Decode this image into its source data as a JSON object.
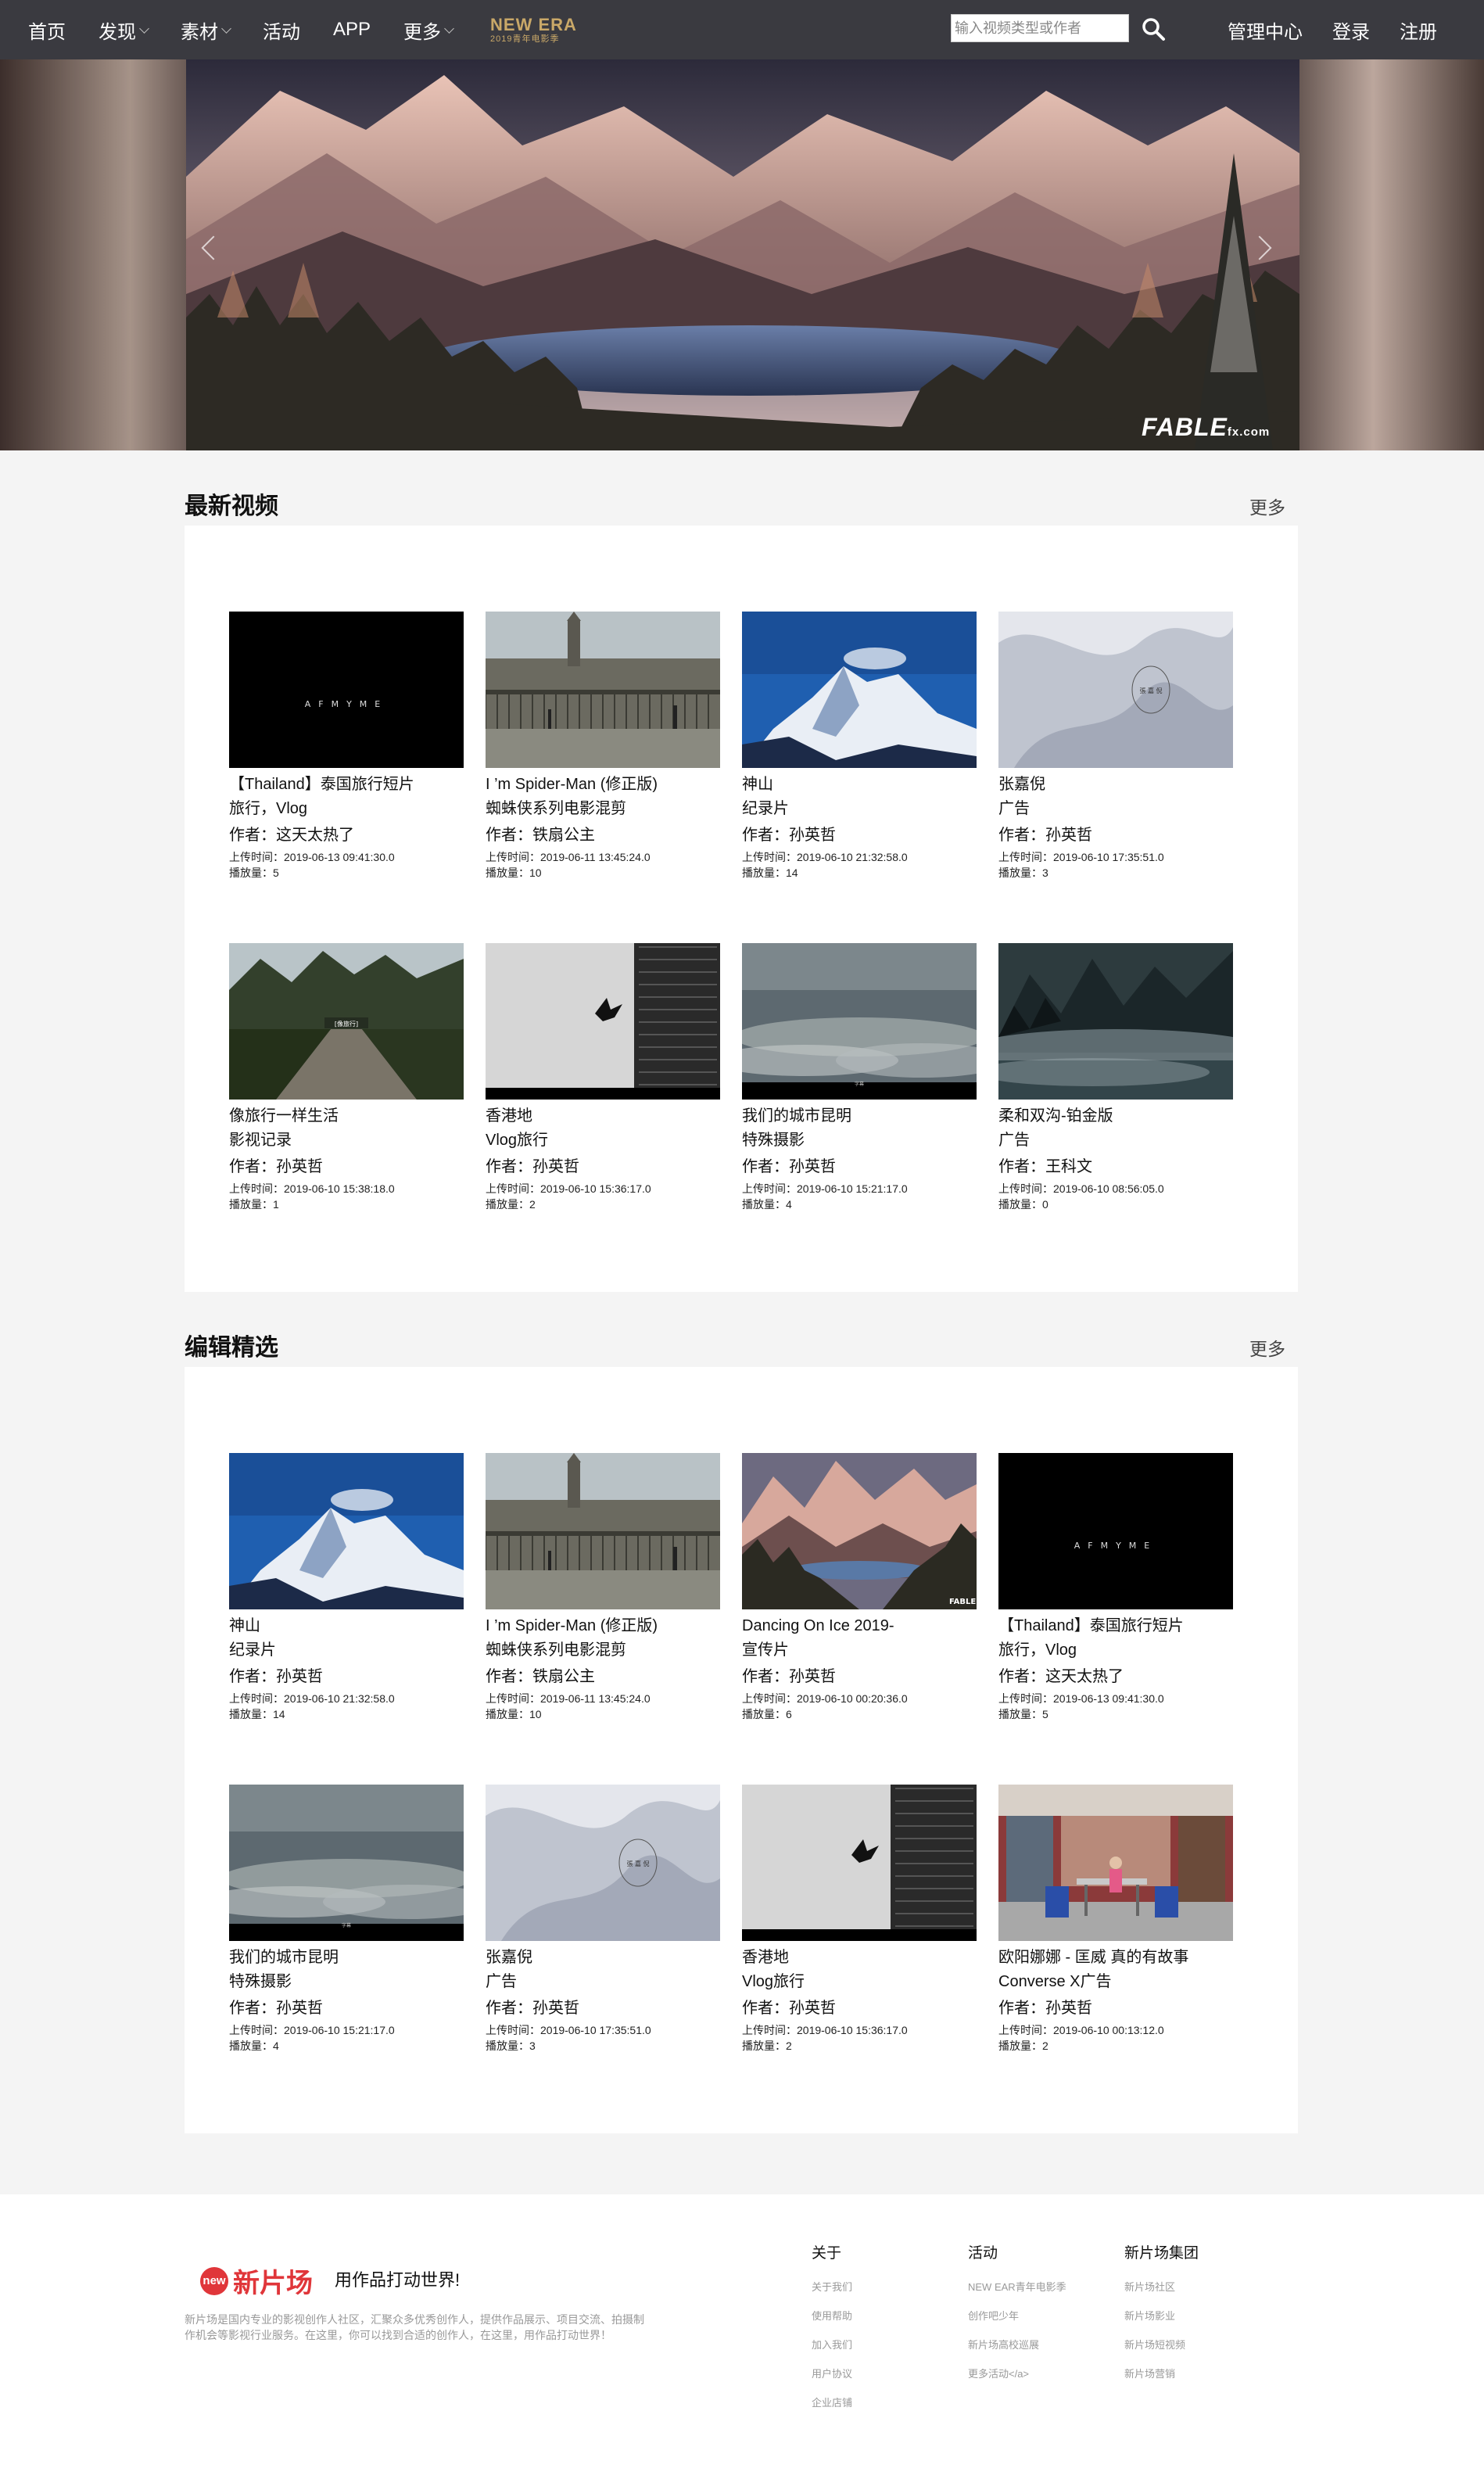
{
  "nav": {
    "items": [
      {
        "label": "首页",
        "dropdown": false
      },
      {
        "label": "发现",
        "dropdown": true
      },
      {
        "label": "素材",
        "dropdown": true
      },
      {
        "label": "活动",
        "dropdown": false
      },
      {
        "label": "APP",
        "dropdown": false
      },
      {
        "label": "更多",
        "dropdown": true
      }
    ],
    "promo_big": "NEW ERA",
    "promo_small": "2019青年电影季",
    "search_placeholder": "输入视频类型或作者",
    "right": [
      "管理中心",
      "登录",
      "注册"
    ]
  },
  "banner": {
    "watermark": "FABLE",
    "watermark_suffix": "fx.com"
  },
  "sections": [
    {
      "title": "最新视频",
      "more": "更多",
      "cards": [
        {
          "title": "【Thailand】泰国旅行短片",
          "category": "旅行，Vlog",
          "author": "作者：这天太热了",
          "upload": "上传时间：2019-06-13 09:41:30.0",
          "plays": "播放量：5",
          "thumb": "afmyme"
        },
        {
          "title": "I ’m Spider-Man (修正版)",
          "category": "蜘蛛侠系列电影混剪",
          "author": "作者：铁扇公主",
          "upload": "上传时间：2019-06-11 13:45:24.0",
          "plays": "播放量：10",
          "thumb": "castle"
        },
        {
          "title": "神山",
          "category": "纪录片",
          "author": "作者：孙英哲",
          "upload": "上传时间：2019-06-10 21:32:58.0",
          "plays": "播放量：14",
          "thumb": "everest"
        },
        {
          "title": "张嘉倪",
          "category": "广告",
          "author": "作者：孙英哲",
          "upload": "上传时间：2019-06-10 17:35:51.0",
          "plays": "播放量：3",
          "thumb": "silk"
        },
        {
          "title": "像旅行一样生活",
          "category": "影视记录",
          "author": "作者：孙英哲",
          "upload": "上传时间：2019-06-10 15:38:18.0",
          "plays": "播放量：1",
          "thumb": "road"
        },
        {
          "title": "香港地",
          "category": "Vlog旅行",
          "author": "作者：孙英哲",
          "upload": "上传时间：2019-06-10 15:36:17.0",
          "plays": "播放量：2",
          "thumb": "bird"
        },
        {
          "title": "我们的城市昆明",
          "category": "特殊摄影",
          "author": "作者：孙英哲",
          "upload": "上传时间：2019-06-10 15:21:17.0",
          "plays": "播放量：4",
          "thumb": "clouds"
        },
        {
          "title": "柔和双沟-铂金版",
          "category": "广告",
          "author": "作者：王科文",
          "upload": "上传时间：2019-06-10 08:56:05.0",
          "plays": "播放量：0",
          "thumb": "fjord"
        }
      ]
    },
    {
      "title": "编辑精选",
      "more": "更多",
      "cards": [
        {
          "title": "神山",
          "category": "纪录片",
          "author": "作者：孙英哲",
          "upload": "上传时间：2019-06-10 21:32:58.0",
          "plays": "播放量：14",
          "thumb": "everest"
        },
        {
          "title": "I ’m Spider-Man (修正版)",
          "category": "蜘蛛侠系列电影混剪",
          "author": "作者：铁扇公主",
          "upload": "上传时间：2019-06-11 13:45:24.0",
          "plays": "播放量：10",
          "thumb": "castle"
        },
        {
          "title": "Dancing On Ice 2019-",
          "category": "宣传片",
          "author": "作者：孙英哲",
          "upload": "上传时间：2019-06-10 00:20:36.0",
          "plays": "播放量：6",
          "thumb": "pinkmtn"
        },
        {
          "title": "【Thailand】泰国旅行短片",
          "category": "旅行，Vlog",
          "author": "作者：这天太热了",
          "upload": "上传时间：2019-06-13 09:41:30.0",
          "plays": "播放量：5",
          "thumb": "afmyme"
        },
        {
          "title": "我们的城市昆明",
          "category": "特殊摄影",
          "author": "作者：孙英哲",
          "upload": "上传时间：2019-06-10 15:21:17.0",
          "plays": "播放量：4",
          "thumb": "clouds"
        },
        {
          "title": "张嘉倪",
          "category": "广告",
          "author": "作者：孙英哲",
          "upload": "上传时间：2019-06-10 17:35:51.0",
          "plays": "播放量：3",
          "thumb": "silk"
        },
        {
          "title": "香港地",
          "category": "Vlog旅行",
          "author": "作者：孙英哲",
          "upload": "上传时间：2019-06-10 15:36:17.0",
          "plays": "播放量：2",
          "thumb": "bird"
        },
        {
          "title": "欧阳娜娜 - 匡威 真的有故事",
          "category": "Converse X广告",
          "author": "作者：孙英哲",
          "upload": "上传时间：2019-06-10 00:13:12.0",
          "plays": "播放量：2",
          "thumb": "mall"
        }
      ]
    }
  ],
  "footer": {
    "logo_badge": "new",
    "logo_name": "新片场",
    "slogan": "用作品打动世界!",
    "description": "新片场是国内专业的影视创作人社区，汇聚众多优秀创作人，提供作品展示、项目交流、拍摄制作机会等影视行业服务。在这里，你可以找到合适的创作人，在这里，用作品打动世界！",
    "columns": [
      {
        "title": "关于",
        "links": [
          "关于我们",
          "使用帮助",
          "加入我们",
          "用户协议",
          "企业店铺"
        ]
      },
      {
        "title": "活动",
        "links": [
          "NEW EAR青年电影季",
          "创作吧少年",
          "新片场高校巡展",
          "更多活动</a>"
        ]
      },
      {
        "title": "新片场集团",
        "links": [
          "新片场社区",
          "新片场影业",
          "新片场短视频",
          "新片场营销"
        ]
      }
    ]
  }
}
